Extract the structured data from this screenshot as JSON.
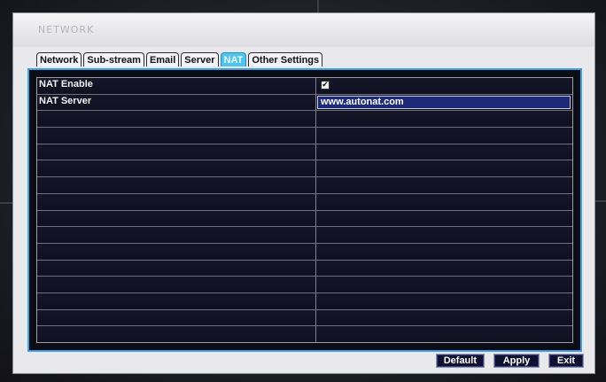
{
  "window": {
    "title": "NETWORK"
  },
  "tabs": [
    {
      "label": "Network",
      "active": false
    },
    {
      "label": "Sub-stream",
      "active": false
    },
    {
      "label": "Email",
      "active": false
    },
    {
      "label": "Server",
      "active": false
    },
    {
      "label": "NAT",
      "active": true
    },
    {
      "label": "Other Settings",
      "active": false
    }
  ],
  "settings": {
    "nat_enable": {
      "label": "NAT Enable",
      "checked": true,
      "check_glyph": "✔"
    },
    "nat_server": {
      "label": "NAT Server",
      "value": "www.autonat.com"
    }
  },
  "buttons": {
    "default_label": "Default",
    "apply_label": "Apply",
    "exit_label": "Exit"
  },
  "colors": {
    "accent_tab": "#4fc4ee",
    "panel_border": "#3fa0e8",
    "input_selected": "#1d2a78"
  }
}
